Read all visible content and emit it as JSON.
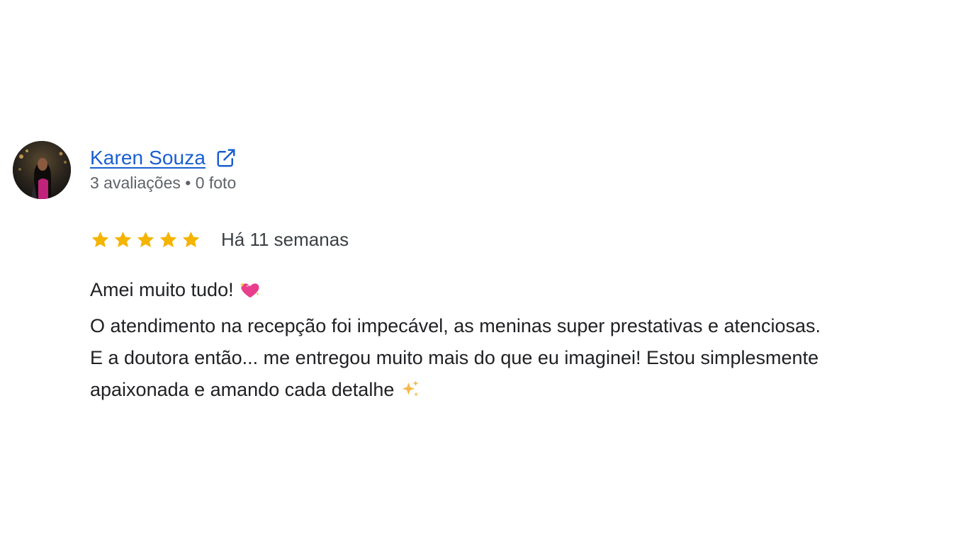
{
  "review": {
    "author": {
      "name": "Karen Souza",
      "meta": "3 avaliações • 0 foto"
    },
    "rating": {
      "stars": 5,
      "max_stars": 5,
      "star_color": "#f4b400"
    },
    "when": "Há 11 semanas",
    "text_lines": [
      "Amei muito tudo!",
      "O atendimento na recepção foi impecável, as meninas super prestativas e atenciosas.",
      "E a doutora então... me entregou muito mais do que eu imaginei! Estou simplesmente",
      "apaixonada e amando cada detalhe"
    ],
    "icons": {
      "open_link": "open-in-new-icon",
      "heart_emoji": "sparkling-heart-icon",
      "sparkles_emoji": "sparkles-icon"
    }
  },
  "colors": {
    "link": "#1a5fd1",
    "meta": "#5f6368",
    "body_text": "#202124"
  }
}
